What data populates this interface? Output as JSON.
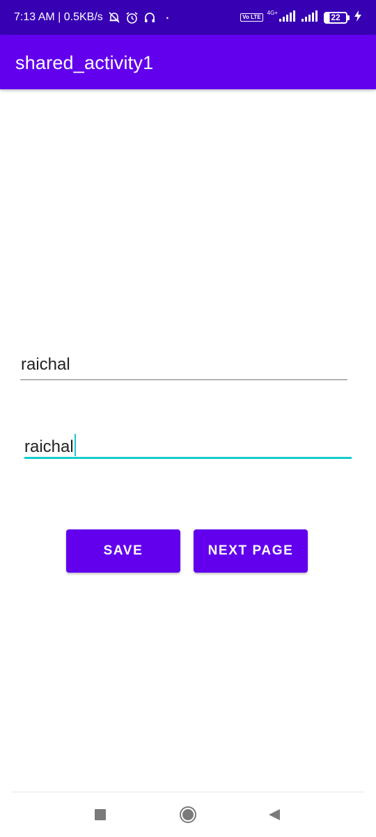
{
  "status_bar": {
    "time_speed": "7:13 AM | 0.5KB/s",
    "dot": "·",
    "volte_label": "Vo LTE",
    "network_type": "4G+",
    "battery_level": "22",
    "icons": [
      "mute-bell-icon",
      "alarm-icon",
      "headphones-icon",
      "signal-icon",
      "signal-icon",
      "battery-icon",
      "charging-bolt-icon"
    ]
  },
  "app_bar": {
    "title": "shared_activity1"
  },
  "form": {
    "field1_value": "raichal",
    "field2_value": "raichal",
    "accent_color": "#16cccc"
  },
  "buttons": {
    "save_label": "SAVE",
    "next_label": "NEXT PAGE"
  },
  "nav_bar": {
    "icons": [
      "recents-square-icon",
      "home-circle-icon",
      "back-triangle-icon"
    ]
  },
  "colors": {
    "status_bar": "#3700b3",
    "primary": "#6200ee",
    "accent": "#16cccc"
  }
}
